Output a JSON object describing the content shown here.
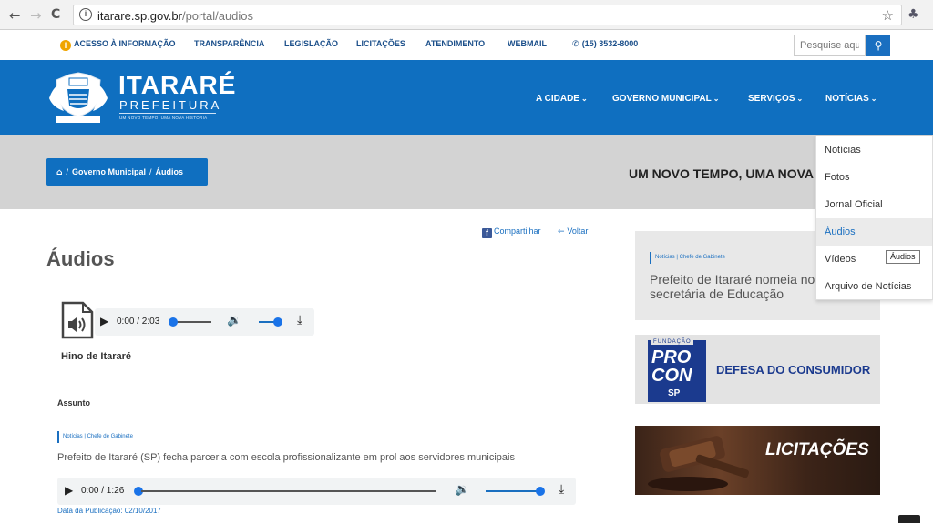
{
  "browser": {
    "back": "←",
    "forward": "→",
    "reload": "C",
    "url_host": "itarare.sp.gov.br",
    "url_path": "/portal/audios",
    "star": "☆"
  },
  "topbar": {
    "links": [
      "ACESSO À INFORMAÇÃO",
      "TRANSPARÊNCIA",
      "LEGISLAÇÃO",
      "LICITAÇÕES",
      "ATENDIMENTO",
      "WEBMAIL",
      "(15) 3532-8000"
    ],
    "search_placeholder": "Pesquise aqui"
  },
  "header": {
    "brand_title": "ITARARÉ",
    "brand_sub": "PREFEITURA",
    "brand_tag": "UM NOVO TEMPO, UMA NOVA HISTÓRIA",
    "menu": [
      "A CIDADE",
      "GOVERNO MUNICIPAL",
      "SERVIÇOS",
      "NOTÍCIAS"
    ]
  },
  "breadcrumb": {
    "items": [
      "Governo Municipal",
      "Áudios"
    ]
  },
  "tagline": "UM NOVO TEMPO, UMA NOVA HISTÓRIA",
  "content": {
    "share_label": "Compartilhar",
    "back_label": "Voltar",
    "title": "Áudios",
    "audio1": {
      "time": "0:00 / 2:03",
      "name": "Hino de Itararé"
    },
    "assunto_label": "Assunto",
    "news_tag": "Notícias | Chefe de Gabinete",
    "news_text": "Prefeito de Itararé (SP) fecha parceria com escola profissionalizante em prol aos servidores municipais",
    "audio2": {
      "time": "0:00 / 1:26"
    },
    "pub_date": "Data da Publicação: 02/10/2017"
  },
  "sidebar": {
    "news_tag": "Notícias | Chefe de Gabinete",
    "news_headline": "Prefeito de Itararé nomeia nova secretária de Educação",
    "procon_fundacao": "FUNDAÇÃO",
    "procon_pro": "PRO",
    "procon_con": "CON",
    "procon_sp": "SP",
    "procon_text": "DEFESA DO CONSUMIDOR",
    "licitacoes_text": "LICITAÇÕES"
  },
  "dropdown": {
    "items": [
      "Notícias",
      "Fotos",
      "Jornal Oficial",
      "Áudios",
      "Vídeos",
      "Arquivo de Notícias"
    ],
    "active_index": 3,
    "tooltip": "Áudios"
  },
  "colors": {
    "brand_blue": "#0f6fc0",
    "band_gray": "#d3d3d3",
    "link_blue": "#1b4f8a"
  }
}
